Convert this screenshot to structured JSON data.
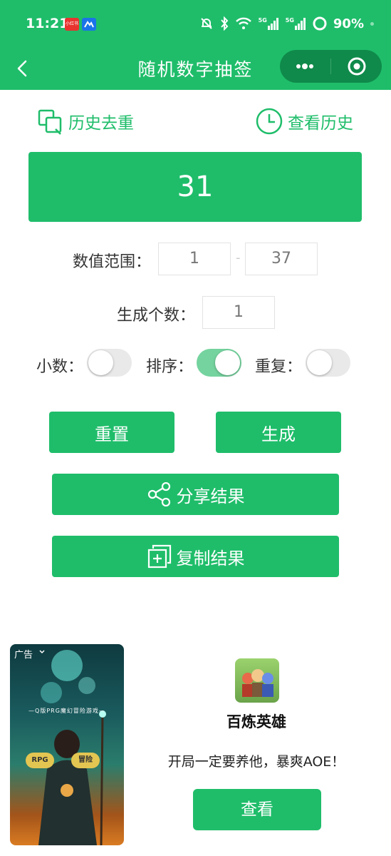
{
  "status_bar": {
    "time": "11:21",
    "app_badge_text": "小红书",
    "network_5g_1": "5G",
    "network_5g_2": "5G",
    "battery": "90%"
  },
  "navbar": {
    "title": "随机数字抽签"
  },
  "links": {
    "dedup_label": "历史去重",
    "history_label": "查看历史"
  },
  "result": {
    "value": "31"
  },
  "range": {
    "label": "数值范围：",
    "min": "1",
    "separator": "-",
    "max": "37"
  },
  "count": {
    "label": "生成个数：",
    "value": "1"
  },
  "options": {
    "decimal_label": "小数：",
    "decimal_on": false,
    "sort_label": "排序：",
    "sort_on": true,
    "repeat_label": "重复：",
    "repeat_on": false
  },
  "buttons": {
    "reset": "重置",
    "generate": "生成",
    "share": "分享结果",
    "copy": "复制结果"
  },
  "ad": {
    "tag": "广告",
    "banner_text": "—Q版PRG魔幻冒险游戏—",
    "badge_rpg": "RPG",
    "badge_adventure": "冒险",
    "app_name": "百炼英雄",
    "description": "开局一定要养他，暴爽AOE！",
    "cta": "查看"
  },
  "colors": {
    "primary": "#1fbd6a",
    "switch_on": "#74d39e",
    "switch_off": "#e9e9e9"
  }
}
